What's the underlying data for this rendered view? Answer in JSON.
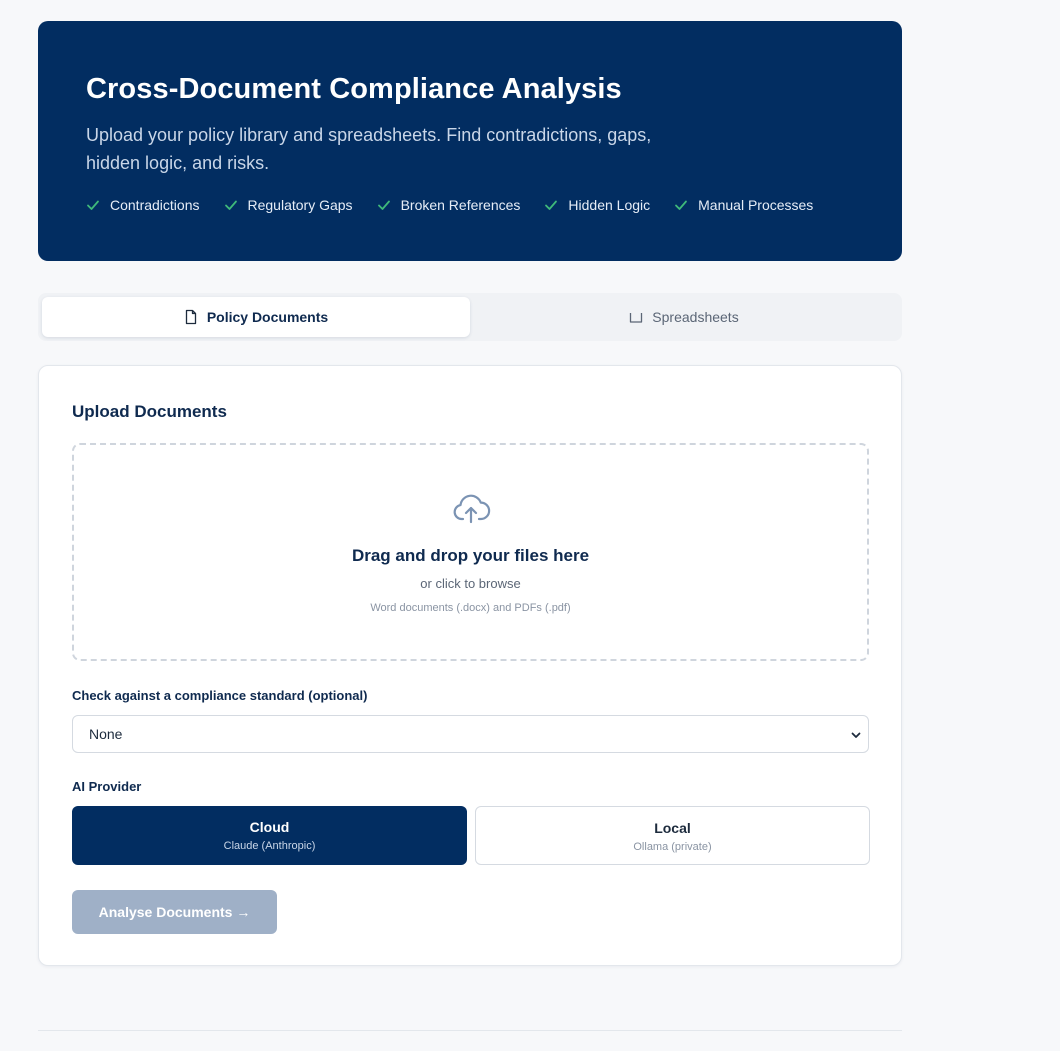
{
  "hero": {
    "title": "Cross-Document Compliance Analysis",
    "subtitle": "Upload your policy library and spreadsheets. Find contradictions, gaps, hidden logic, and risks.",
    "features": [
      "Contradictions",
      "Regulatory Gaps",
      "Broken References",
      "Hidden Logic",
      "Manual Processes"
    ],
    "check_color": "#3fb97a",
    "background": "#022d61"
  },
  "tabs": [
    {
      "label": "Policy Documents",
      "icon": "document-icon",
      "active": true
    },
    {
      "label": "Spreadsheets",
      "icon": "spreadsheet-icon",
      "active": false
    }
  ],
  "upload": {
    "title": "Upload Documents",
    "dropzone_title": "Drag and drop your files here",
    "dropzone_sub": "or click to browse",
    "dropzone_hint": "Word documents (.docx) and PDFs (.pdf)",
    "icon": "cloud-upload-icon"
  },
  "standard": {
    "label": "Check against a compliance standard (optional)",
    "selected": "None"
  },
  "provider": {
    "label": "AI Provider",
    "options": [
      {
        "name": "Cloud",
        "desc": "Claude (Anthropic)",
        "selected": true
      },
      {
        "name": "Local",
        "desc": "Ollama (private)",
        "selected": false
      }
    ]
  },
  "actions": {
    "analyse_label": "Analyse Documents →",
    "disabled_color": "#9fb0c7"
  }
}
